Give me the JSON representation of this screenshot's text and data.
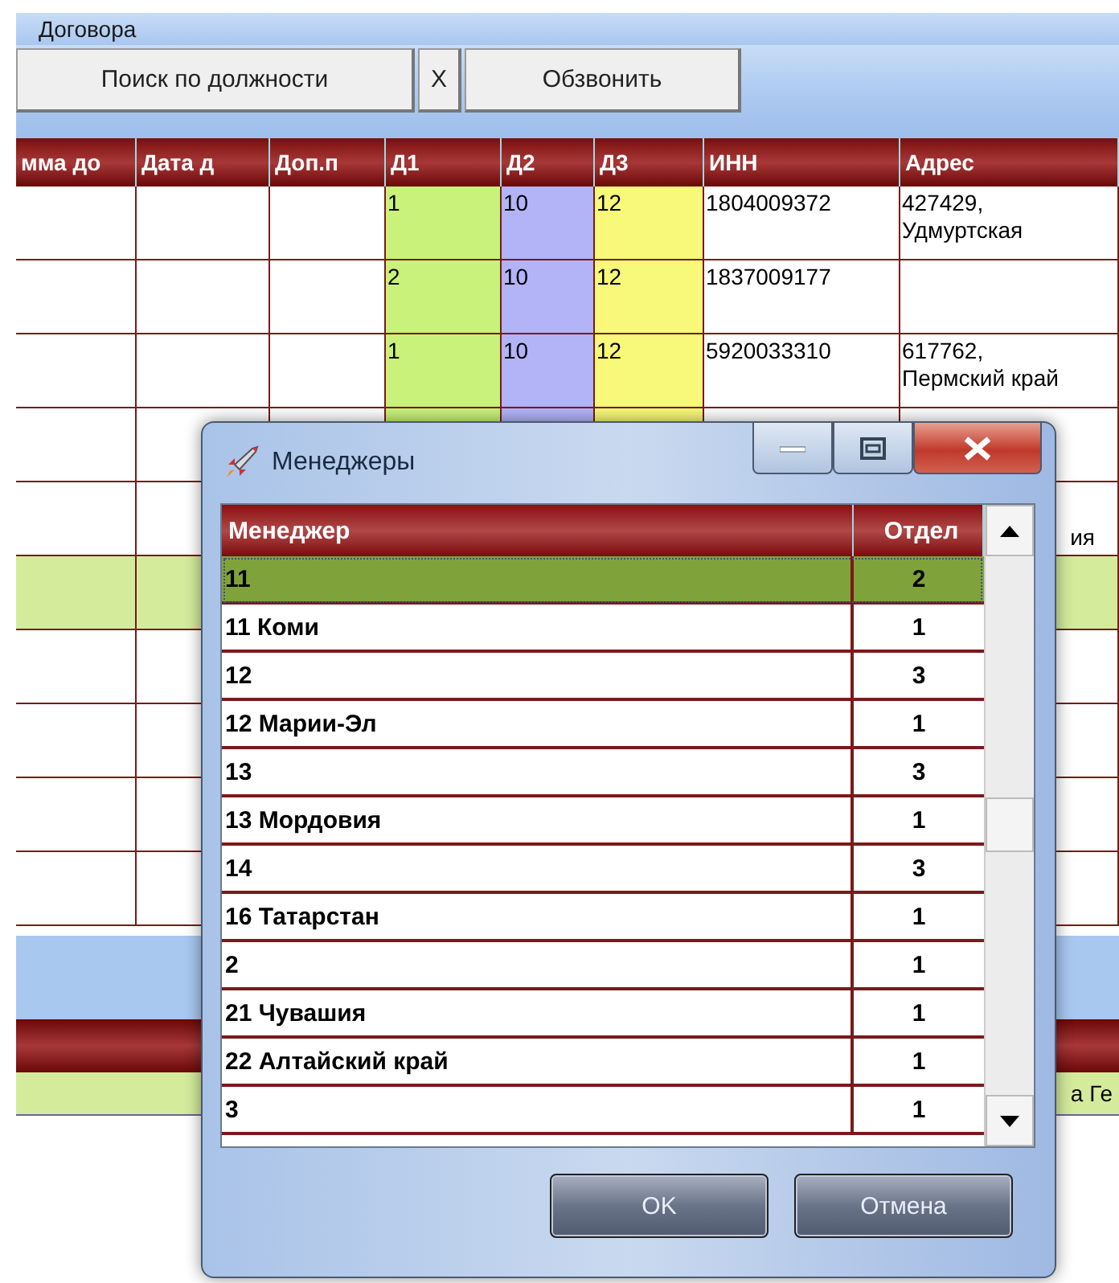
{
  "window": {
    "title": "Договора"
  },
  "toolbar": {
    "buttons": [
      {
        "label": "Поиск по должности",
        "kind": "wide"
      },
      {
        "label": "X",
        "kind": "narrow"
      },
      {
        "label": "Обзвонить",
        "kind": "wide"
      }
    ]
  },
  "table": {
    "columns": [
      {
        "label": "мма до"
      },
      {
        "label": "Дата д"
      },
      {
        "label": "Доп.п"
      },
      {
        "label": "Д1",
        "color": "#c8f27a"
      },
      {
        "label": "Д2",
        "color": "#b3b3f8"
      },
      {
        "label": "Д3",
        "color": "#f8f87a"
      },
      {
        "label": "ИНН"
      },
      {
        "label": "Адрес"
      }
    ],
    "rows": [
      {
        "highlighted": false,
        "d1": "1",
        "d2": "10",
        "d3": "12",
        "inn": "1804009372",
        "address": [
          "427429,",
          "Удмуртская"
        ]
      },
      {
        "highlighted": false,
        "d1": "2",
        "d2": "10",
        "d3": "12",
        "inn": "1837009177"
      },
      {
        "highlighted": false,
        "d1": "1",
        "d2": "10",
        "d3": "12",
        "inn": "5920033310",
        "address": [
          "617762,",
          "Пермский край"
        ]
      },
      {
        "highlighted": false
      },
      {
        "highlighted": false,
        "address_tail": "ия"
      },
      {
        "highlighted": true
      },
      {
        "highlighted": false
      },
      {
        "highlighted": false
      },
      {
        "highlighted": false
      },
      {
        "highlighted": false
      }
    ]
  },
  "footer": {
    "text_tail": "а Ге"
  },
  "dialog": {
    "title": "Менеджеры",
    "columns": [
      "Менеджер",
      "Отдел"
    ],
    "rows": [
      {
        "name": "11",
        "dept": "2",
        "selected": true
      },
      {
        "name": "11 Коми",
        "dept": "1",
        "selected": false
      },
      {
        "name": "12",
        "dept": "3",
        "selected": false
      },
      {
        "name": "12 Марии-Эл",
        "dept": "1",
        "selected": false
      },
      {
        "name": "13",
        "dept": "3",
        "selected": false
      },
      {
        "name": "13 Мордовия",
        "dept": "1",
        "selected": false
      },
      {
        "name": "14",
        "dept": "3",
        "selected": false
      },
      {
        "name": "16 Татарстан",
        "dept": "1",
        "selected": false
      },
      {
        "name": "2",
        "dept": "1",
        "selected": false
      },
      {
        "name": "21 Чувашия",
        "dept": "1",
        "selected": false
      },
      {
        "name": "22 Алтайский край",
        "dept": "1",
        "selected": false
      },
      {
        "name": "3",
        "dept": "1",
        "selected": false
      }
    ],
    "buttons": [
      "OK",
      "Отмена"
    ]
  }
}
